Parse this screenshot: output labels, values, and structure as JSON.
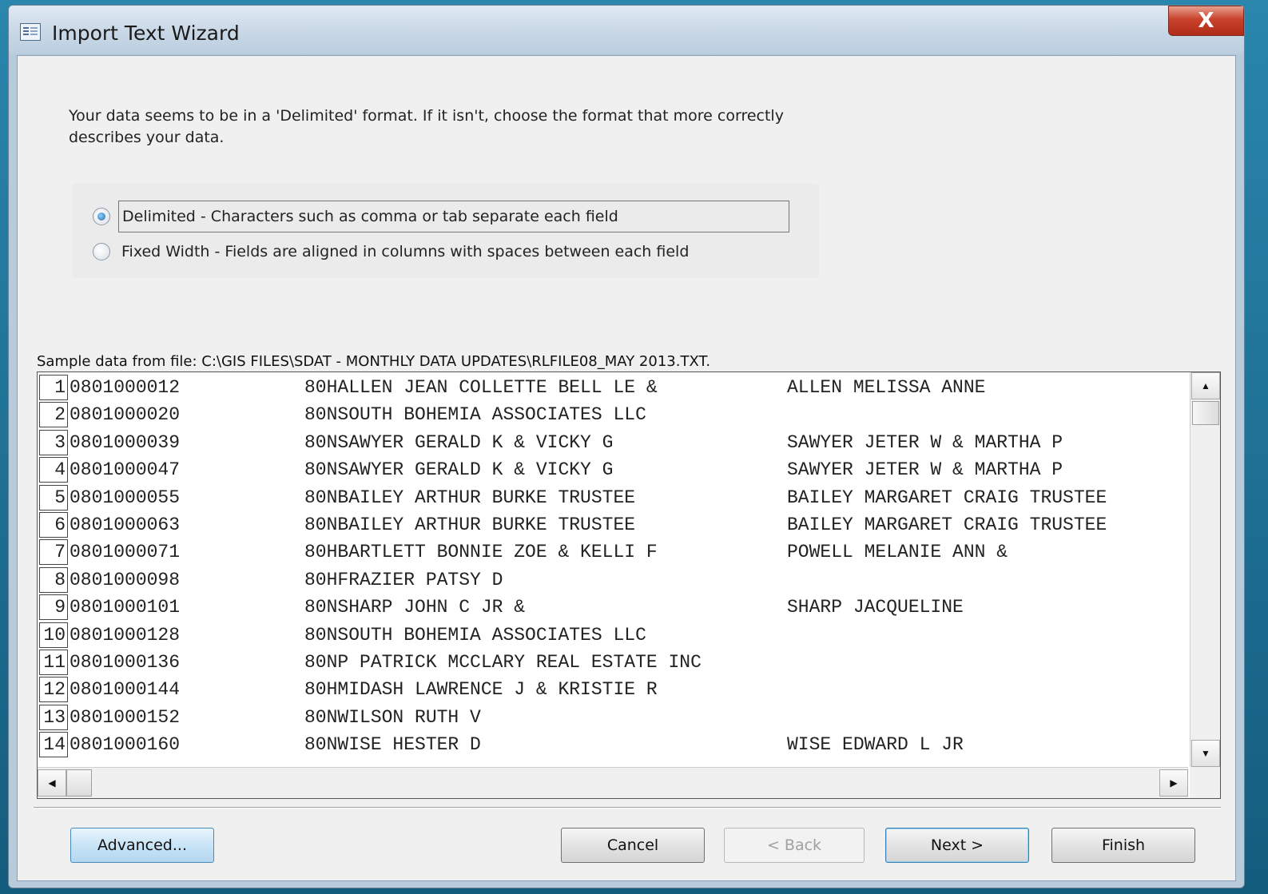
{
  "window": {
    "title": "Import Text Wizard",
    "close_glyph": "X"
  },
  "instruction": "Your data seems to be in a 'Delimited' format. If it isn't, choose the format that more correctly describes your data.",
  "format": {
    "selected": "delimited",
    "options": [
      {
        "label": "Delimited - Characters such as comma or tab separate each field"
      },
      {
        "label": "Fixed Width - Fields are aligned in columns with spaces between each field"
      }
    ]
  },
  "sample": {
    "label": "Sample data from file: C:\\GIS FILES\\SDAT - MONTHLY DATA UPDATES\\RLFILE08_MAY 2013.TXT.",
    "rows": [
      {
        "num": "1",
        "id": "0801000012",
        "owner": "80HALLEN JEAN COLLETTE BELL LE &",
        "owner2": "ALLEN MELISSA ANNE"
      },
      {
        "num": "2",
        "id": "0801000020",
        "owner": "80NSOUTH BOHEMIA ASSOCIATES LLC",
        "owner2": ""
      },
      {
        "num": "3",
        "id": "0801000039",
        "owner": "80NSAWYER GERALD K & VICKY G",
        "owner2": "SAWYER JETER W & MARTHA P"
      },
      {
        "num": "4",
        "id": "0801000047",
        "owner": "80NSAWYER GERALD K & VICKY G",
        "owner2": "SAWYER JETER W & MARTHA P"
      },
      {
        "num": "5",
        "id": "0801000055",
        "owner": "80NBAILEY ARTHUR BURKE TRUSTEE",
        "owner2": "BAILEY MARGARET CRAIG TRUSTEE"
      },
      {
        "num": "6",
        "id": "0801000063",
        "owner": "80NBAILEY ARTHUR BURKE TRUSTEE",
        "owner2": "BAILEY MARGARET CRAIG TRUSTEE"
      },
      {
        "num": "7",
        "id": "0801000071",
        "owner": "80HBARTLETT BONNIE ZOE & KELLI F",
        "owner2": "POWELL MELANIE ANN &"
      },
      {
        "num": "8",
        "id": "0801000098",
        "owner": "80HFRAZIER PATSY D",
        "owner2": ""
      },
      {
        "num": "9",
        "id": "0801000101",
        "owner": "80NSHARP JOHN C JR &",
        "owner2": "SHARP JACQUELINE"
      },
      {
        "num": "10",
        "id": "0801000128",
        "owner": "80NSOUTH BOHEMIA ASSOCIATES LLC",
        "owner2": ""
      },
      {
        "num": "11",
        "id": "0801000136",
        "owner": "80NP PATRICK MCCLARY REAL ESTATE INC",
        "owner2": ""
      },
      {
        "num": "12",
        "id": "0801000144",
        "owner": "80HMIDASH LAWRENCE J & KRISTIE R",
        "owner2": ""
      },
      {
        "num": "13",
        "id": "0801000152",
        "owner": "80NWILSON RUTH V",
        "owner2": ""
      },
      {
        "num": "14",
        "id": "0801000160",
        "owner": "80NWISE HESTER D",
        "owner2": "WISE EDWARD L JR"
      }
    ]
  },
  "scroll": {
    "up": "▲",
    "down": "▼",
    "left": "◀",
    "right": "▶"
  },
  "buttons": {
    "advanced": "Advanced...",
    "cancel": "Cancel",
    "back": "< Back",
    "next": "Next >",
    "finish": "Finish"
  }
}
